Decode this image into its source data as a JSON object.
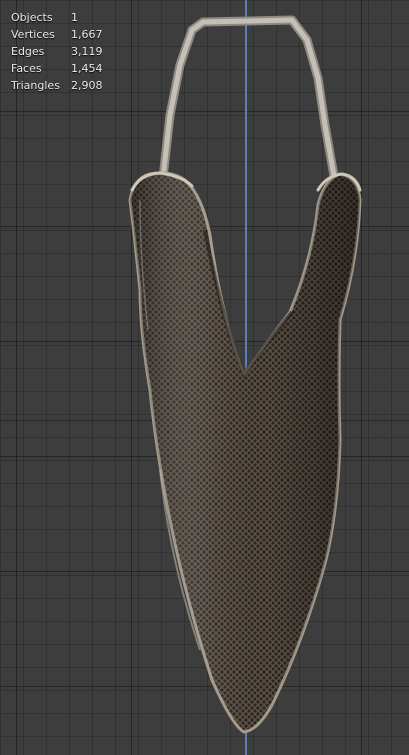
{
  "stats": {
    "rows": [
      {
        "label": "Objects",
        "value": "1"
      },
      {
        "label": "Vertices",
        "value": "1,667"
      },
      {
        "label": "Edges",
        "value": "3,119"
      },
      {
        "label": "Faces",
        "value": "1,454"
      },
      {
        "label": "Triangles",
        "value": "2,908"
      }
    ]
  },
  "colors": {
    "background": "#3d3d3d",
    "axis": "#5a7fbd",
    "strap": "#b8b4ab",
    "mesh_dark": "#2a2420",
    "mesh_mid": "#6b5d50",
    "edge": "#a49a8c"
  }
}
